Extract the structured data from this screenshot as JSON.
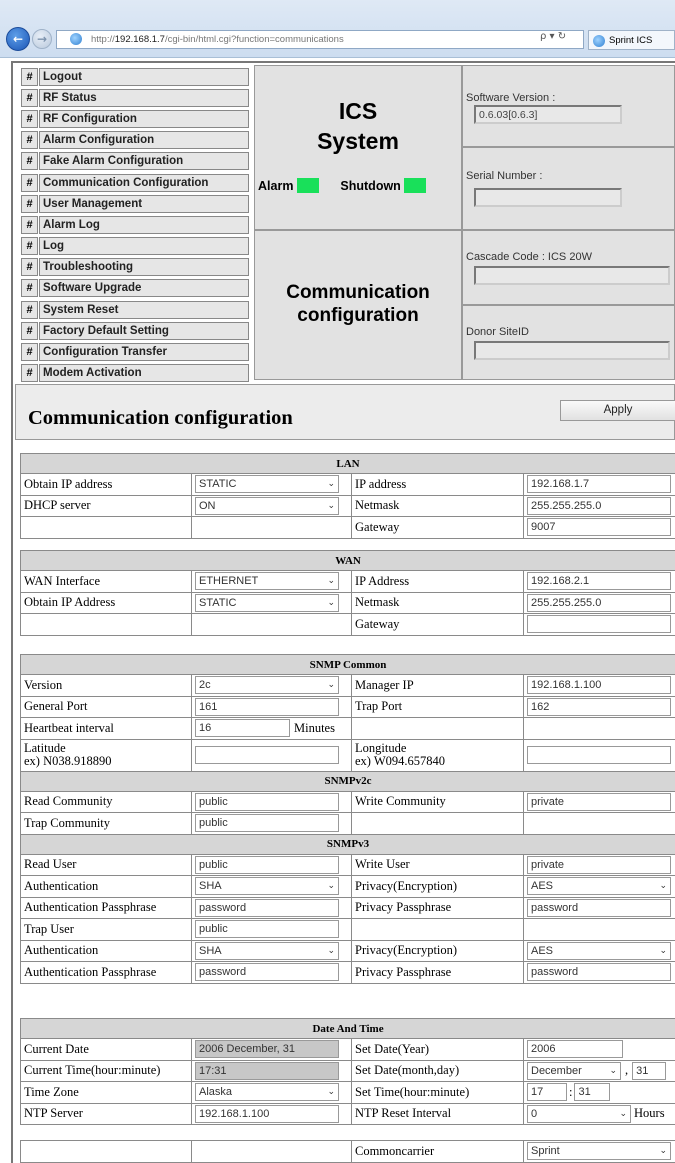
{
  "browser": {
    "address_prefix": "http://",
    "address_host": "192.168.1.7",
    "address_path": "/cgi-bin/html.cgi?function=communications",
    "address_tools": "ρ ▾ ↻",
    "tab_label": "Sprint ICS"
  },
  "menu": [
    {
      "hash": "#",
      "label": "Logout"
    },
    {
      "hash": "#",
      "label": "RF Status"
    },
    {
      "hash": "#",
      "label": "RF Configuration"
    },
    {
      "hash": "#",
      "label": "Alarm Configuration"
    },
    {
      "hash": "#",
      "label": "Fake Alarm Configuration"
    },
    {
      "hash": "#",
      "label": "Communication Configuration"
    },
    {
      "hash": "#",
      "label": "User Management"
    },
    {
      "hash": "#",
      "label": "Alarm Log"
    },
    {
      "hash": "#",
      "label": "Log"
    },
    {
      "hash": "#",
      "label": "Troubleshooting"
    },
    {
      "hash": "#",
      "label": "Software Upgrade"
    },
    {
      "hash": "#",
      "label": "System Reset"
    },
    {
      "hash": "#",
      "label": "Factory Default Setting"
    },
    {
      "hash": "#",
      "label": "Configuration Transfer"
    },
    {
      "hash": "#",
      "label": "Modem Activation"
    }
  ],
  "header": {
    "system_title_1": "ICS",
    "system_title_2": "System",
    "alarm_label": "Alarm",
    "shutdown_label": "Shutdown",
    "led_color": "#19e05a",
    "page_title_1": "Communication",
    "page_title_2": "configuration"
  },
  "info": {
    "software_version_label": "Software Version :",
    "software_version_value": "0.6.03[0.6.3]",
    "serial_number_label": "Serial Number :",
    "serial_number_value": "",
    "cascade_code_label": "Cascade Code : ICS 20W",
    "cascade_code_value": "",
    "donor_siteid_label": "Donor SiteID",
    "donor_siteid_value": ""
  },
  "config": {
    "title": "Communication configuration",
    "apply_label": "Apply"
  },
  "lan": {
    "header": "LAN",
    "obtain_ip_label": "Obtain IP address",
    "obtain_ip_value": "STATIC",
    "ip_label": "IP address",
    "ip_value": "192.168.1.7",
    "dhcp_label": "DHCP server",
    "dhcp_value": "ON",
    "netmask_label": "Netmask",
    "netmask_value": "255.255.255.0",
    "gateway_label": "Gateway",
    "gateway_value": "9007"
  },
  "wan": {
    "header": "WAN",
    "interface_label": "WAN Interface",
    "interface_value": "ETHERNET",
    "ip_label": "IP Address",
    "ip_value": "192.168.2.1",
    "obtain_ip_label": "Obtain IP Address",
    "obtain_ip_value": "STATIC",
    "netmask_label": "Netmask",
    "netmask_value": "255.255.255.0",
    "gateway_label": "Gateway",
    "gateway_value": ""
  },
  "snmp_common": {
    "header": "SNMP Common",
    "version_label": "Version",
    "version_value": "2c",
    "manager_ip_label": "Manager IP",
    "manager_ip_value": "192.168.1.100",
    "general_port_label": "General Port",
    "general_port_value": "161",
    "trap_port_label": "Trap Port",
    "trap_port_value": "162",
    "heartbeat_label": "Heartbeat interval",
    "heartbeat_value": "16",
    "heartbeat_unit": "Minutes",
    "latitude_label": "Latitude",
    "latitude_example": "ex) N038.918890",
    "latitude_value": "",
    "longitude_label": "Longitude",
    "longitude_example": "ex) W094.657840",
    "longitude_value": ""
  },
  "snmpv2c": {
    "header": "SNMPv2c",
    "read_community_label": "Read Community",
    "read_community_value": "public",
    "write_community_label": "Write Community",
    "write_community_value": "private",
    "trap_community_label": "Trap Community",
    "trap_community_value": "public"
  },
  "snmpv3": {
    "header": "SNMPv3",
    "read_user_label": "Read User",
    "read_user_value": "public",
    "write_user_label": "Write User",
    "write_user_value": "private",
    "auth_label": "Authentication",
    "auth_value": "SHA",
    "privacy_label": "Privacy(Encryption)",
    "privacy_value": "AES",
    "auth_pass_label": "Authentication Passphrase",
    "auth_pass_value": "password",
    "privacy_pass_label": "Privacy Passphrase",
    "privacy_pass_value": "password",
    "trap_user_label": "Trap User",
    "trap_user_value": "public",
    "trap_auth_label": "Authentication",
    "trap_auth_value": "SHA",
    "trap_privacy_label": "Privacy(Encryption)",
    "trap_privacy_value": "AES",
    "trap_auth_pass_label": "Authentication Passphrase",
    "trap_auth_pass_value": "password",
    "trap_privacy_pass_label": "Privacy Passphrase",
    "trap_privacy_pass_value": "password"
  },
  "datetime": {
    "header": "Date And Time",
    "current_date_label": "Current Date",
    "current_date_value": "2006 December, 31",
    "set_year_label": "Set Date(Year)",
    "set_year_value": "2006",
    "current_time_label": "Current Time(hour:minute)",
    "current_time_value": "17:31",
    "set_month_day_label": "Set Date(month,day)",
    "set_month_value": "December",
    "set_day_sep": ",",
    "set_day_value": "31",
    "timezone_label": "Time Zone",
    "timezone_value": "Alaska",
    "set_time_label": "Set Time(hour:minute)",
    "set_hour_value": "17",
    "set_time_sep": ":",
    "set_minute_value": "31",
    "ntp_server_label": "NTP Server",
    "ntp_server_value": "192.168.1.100",
    "ntp_reset_label": "NTP Reset Interval",
    "ntp_reset_value": "0",
    "ntp_reset_unit": "Hours"
  },
  "carrier": {
    "label": "Commoncarrier",
    "value": "Sprint"
  },
  "icons": {
    "back": "back-arrow-icon",
    "forward": "forward-arrow-icon",
    "page": "ie-page-icon",
    "chevron": "chevron-down-icon"
  }
}
